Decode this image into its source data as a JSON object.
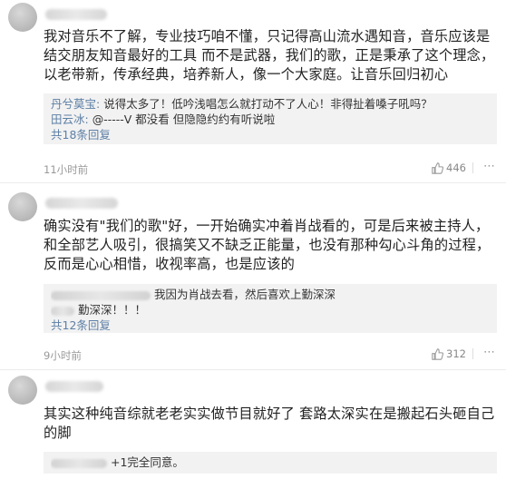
{
  "comments": [
    {
      "text": "我对音乐不了解，专业技巧咱不懂，只记得高山流水遇知音，音乐应该是结交朋友知音最好的工具 而不是武器，我们的歌，正是秉承了这个理念，以老带新，传承经典，培养新人，像一个大家庭。让音乐回归初心",
      "replies": [
        {
          "name": "丹兮莫宝",
          "text": "说得太多了！低吟浅唱怎么就打动不了人心！非得扯着嗓子吼吗？"
        },
        {
          "name": "田云冰",
          "text": "@-----V 都没看 但隐隐约约有听说啦"
        }
      ],
      "reply_count": "共18条回复",
      "time": "11小时前",
      "likes": "446"
    },
    {
      "text": "确实没有\"我们的歌\"好，一开始确实冲着肖战看的，可是后来被主持人，和全部艺人吸引，很搞笑又不缺乏正能量，也没有那种勾心斗角的过程，反而是心心相惜，收视率高，也是应该的",
      "replies": [
        {
          "name": "",
          "text": "我因为肖战去看，然后喜欢上勤深深"
        },
        {
          "name": "",
          "text": "勤深深！！！"
        }
      ],
      "reply_count": "共12条回复",
      "time": "9小时前",
      "likes": "312"
    },
    {
      "text": "其实这种纯音综就老老实实做节目就好了 套路太深实在是搬起石头砸自己的脚",
      "replies": [
        {
          "name": "",
          "text": "+1完全同意。"
        }
      ]
    }
  ],
  "icons": {
    "like": "thumbs-up-icon",
    "more": "more-icon"
  }
}
